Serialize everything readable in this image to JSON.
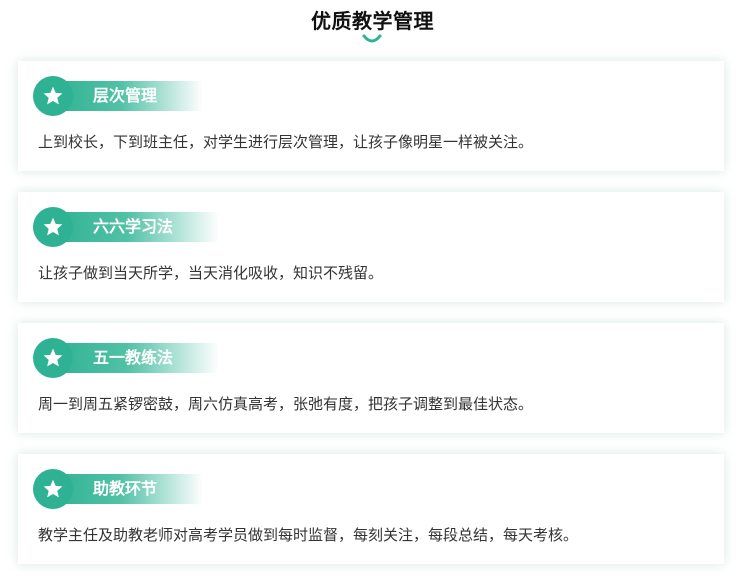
{
  "page": {
    "title": "优质教学管理"
  },
  "colors": {
    "accent": "#2fb293",
    "text": "#333333",
    "title": "#111111"
  },
  "icons": {
    "title_decoration": "smile-icon",
    "badge": "star-icon"
  },
  "sections": [
    {
      "heading": "层次管理",
      "text": "上到校长，下到班主任，对学生进行层次管理，让孩子像明星一样被关注。"
    },
    {
      "heading": "六六学习法",
      "text": "让孩子做到当天所学，当天消化吸收，知识不残留。"
    },
    {
      "heading": "五一教练法",
      "text": "周一到周五紧锣密鼓，周六仿真高考，张弛有度，把孩子调整到最佳状态。"
    },
    {
      "heading": "助教环节",
      "text": "教学主任及助教老师对高考学员做到每时监督，每刻关注，每段总结，每天考核。"
    }
  ]
}
